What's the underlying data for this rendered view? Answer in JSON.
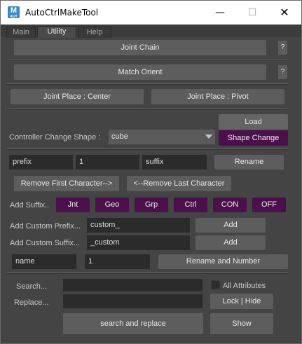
{
  "window": {
    "title": "AutoCtrlMakeTool",
    "icon_letter": "M",
    "icon_sub": "AUT",
    "minimize": "—",
    "maximize": "☐",
    "close": "✕"
  },
  "tabs": [
    "Main",
    "Utility",
    "Help"
  ],
  "active_tab": "Utility",
  "joint_chain": {
    "label": "Joint Chain",
    "help": "?"
  },
  "match_orient": {
    "label": "Match Orient",
    "help": "?"
  },
  "joint_place": {
    "center": "Joint Place : Center",
    "pivot": "Joint Place : Pivot"
  },
  "shape": {
    "load_label": "Load",
    "change_label": "Controller Change Shape :",
    "selected": "cube",
    "button": "Shape Change"
  },
  "rename": {
    "prefix": "prefix",
    "number": "1",
    "suffix": "suffix",
    "button": "Rename",
    "remove_first": "Remove First Character-->",
    "remove_last": "<--Remove Last Character"
  },
  "suffix": {
    "label": "Add Suffix..",
    "options": [
      "Jnt",
      "Geo",
      "Grp",
      "Ctrl",
      "CON",
      "OFF"
    ]
  },
  "custom_prefix": {
    "label": "Add Custom Prefix...",
    "value": "custom_",
    "button": "Add"
  },
  "custom_suffix": {
    "label": "Add Custom Suffix...",
    "value": "_custom",
    "button": "Add"
  },
  "rename_number": {
    "name": "name",
    "number": "1",
    "button": "Rename and Number"
  },
  "search": {
    "search_label": "Search...",
    "search_value": "",
    "replace_label": "Replace...",
    "replace_value": "",
    "all_attributes": "All Attributes",
    "lock_hide": "Lock | Hide",
    "search_replace": "search and replace",
    "show": "Show"
  },
  "colors": {
    "accent_purple": "#4b0f4c",
    "panel": "#444444",
    "field": "#2b2b2b",
    "button": "#5d5d5d"
  }
}
